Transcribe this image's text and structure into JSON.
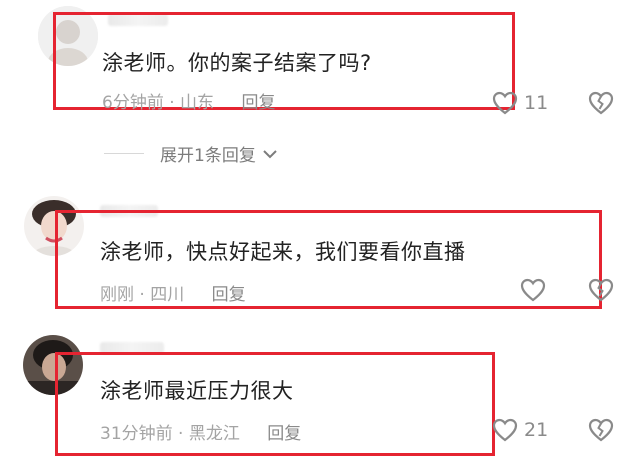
{
  "comments": [
    {
      "text": "涂老师。你的案子结案了吗?",
      "time": "6分钟前",
      "location": "山东",
      "reply_label": "回复",
      "like_count": "11"
    },
    {
      "text": "涂老师，快点好起来，我们要看你直播",
      "time": "刚刚",
      "location": "四川",
      "reply_label": "回复",
      "like_count": ""
    },
    {
      "text": "涂老师最近压力很大",
      "time": "31分钟前",
      "location": "黑龙江",
      "reply_label": "回复",
      "like_count": "21"
    }
  ],
  "expand_replies": {
    "label": "展开1条回复"
  },
  "separator": "·",
  "icons": {
    "like": "heart-outline-icon",
    "dislike": "broken-heart-icon",
    "expand": "chevron-down-icon"
  },
  "colors": {
    "highlight": "#e52431",
    "meta": "#a4a4a4",
    "text": "#222222"
  }
}
